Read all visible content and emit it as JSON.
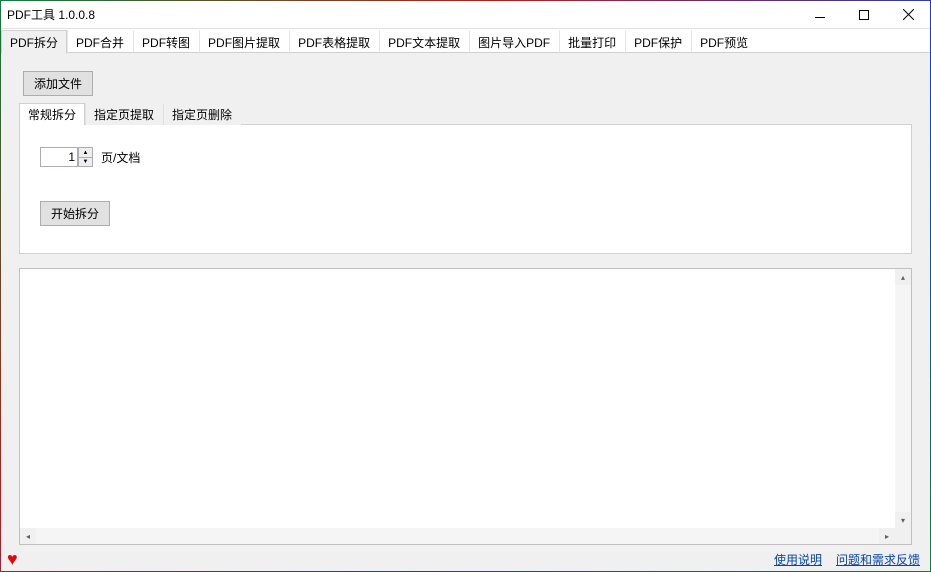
{
  "window": {
    "title": "PDF工具 1.0.0.8"
  },
  "mainTabs": [
    {
      "label": "PDF拆分"
    },
    {
      "label": "PDF合并"
    },
    {
      "label": "PDF转图"
    },
    {
      "label": "PDF图片提取"
    },
    {
      "label": "PDF表格提取"
    },
    {
      "label": "PDF文本提取"
    },
    {
      "label": "图片导入PDF"
    },
    {
      "label": "批量打印"
    },
    {
      "label": "PDF保护"
    },
    {
      "label": "PDF预览"
    }
  ],
  "activeMainTab": 0,
  "addFileButton": "添加文件",
  "subTabs": [
    {
      "label": "常规拆分"
    },
    {
      "label": "指定页提取"
    },
    {
      "label": "指定页删除"
    }
  ],
  "activeSubTab": 0,
  "split": {
    "pagesPerDocValue": "1",
    "pagesPerDocLabel": "页/文档",
    "startButton": "开始拆分"
  },
  "footer": {
    "heartIcon": "♥",
    "usageLink": "使用说明",
    "feedbackLink": "问题和需求反馈"
  }
}
